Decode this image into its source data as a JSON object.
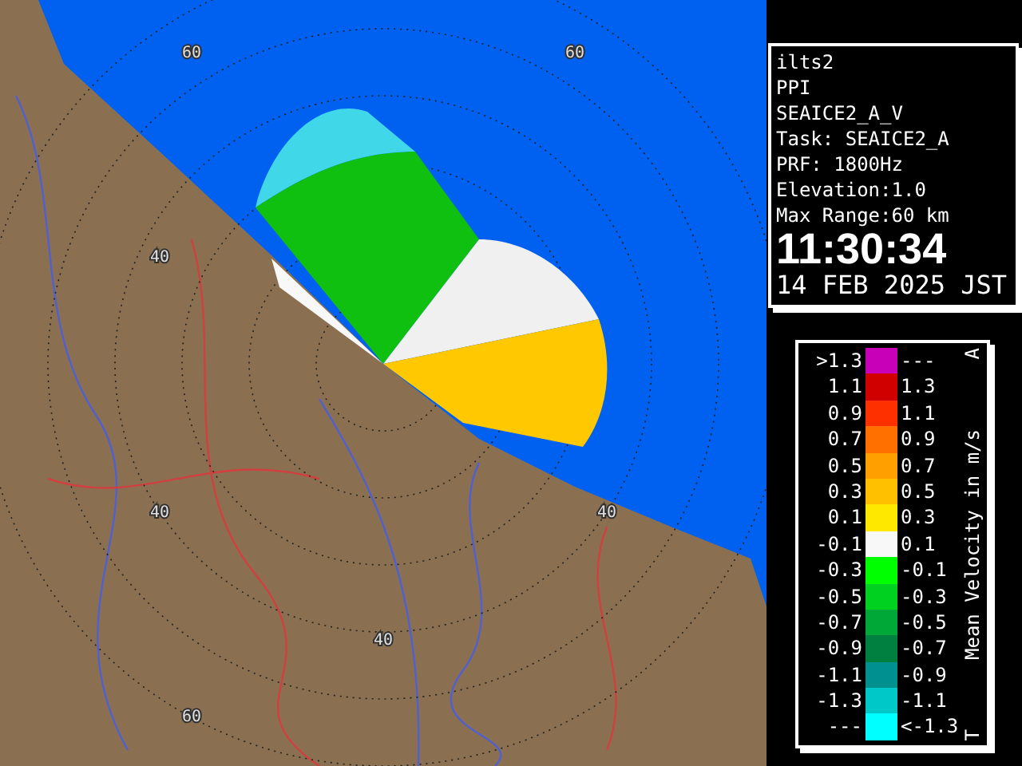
{
  "map": {
    "range_labels": [
      "60",
      "60",
      "40",
      "40",
      "40",
      "40",
      "60"
    ]
  },
  "info": {
    "lines": [
      "ilts2",
      "PPI",
      "SEAICE2_A_V",
      "Task: SEAICE2_A",
      "PRF: 1800Hz",
      "Elevation:1.0",
      "Max Range:60 km"
    ],
    "time": "11:30:34",
    "date": "14 FEB 2025 JST"
  },
  "legend": {
    "title": "Mean Velocity in m/s",
    "top_mark": "A",
    "bottom_mark": "T",
    "rows": [
      {
        "low": ">1.3",
        "high": "---",
        "color": "#c800b8"
      },
      {
        "low": "1.1",
        "high": "1.3",
        "color": "#d00000"
      },
      {
        "low": "0.9",
        "high": "1.1",
        "color": "#ff3000"
      },
      {
        "low": "0.7",
        "high": "0.9",
        "color": "#ff7000"
      },
      {
        "low": "0.5",
        "high": "0.7",
        "color": "#ffa000"
      },
      {
        "low": "0.3",
        "high": "0.5",
        "color": "#ffc000"
      },
      {
        "low": "0.1",
        "high": "0.3",
        "color": "#ffe800"
      },
      {
        "low": "-0.1",
        "high": "0.1",
        "color": "#f8f8f8"
      },
      {
        "low": "-0.3",
        "high": "-0.1",
        "color": "#00ff00"
      },
      {
        "low": "-0.5",
        "high": "-0.3",
        "color": "#00d020"
      },
      {
        "low": "-0.7",
        "high": "-0.5",
        "color": "#00a838"
      },
      {
        "low": "-0.9",
        "high": "-0.7",
        "color": "#008040"
      },
      {
        "low": "-1.1",
        "high": "-0.9",
        "color": "#009090"
      },
      {
        "low": "-1.3",
        "high": "-1.1",
        "color": "#00c8c8"
      },
      {
        "low": "---",
        "high": "<-1.3",
        "color": "#00ffff"
      }
    ]
  }
}
